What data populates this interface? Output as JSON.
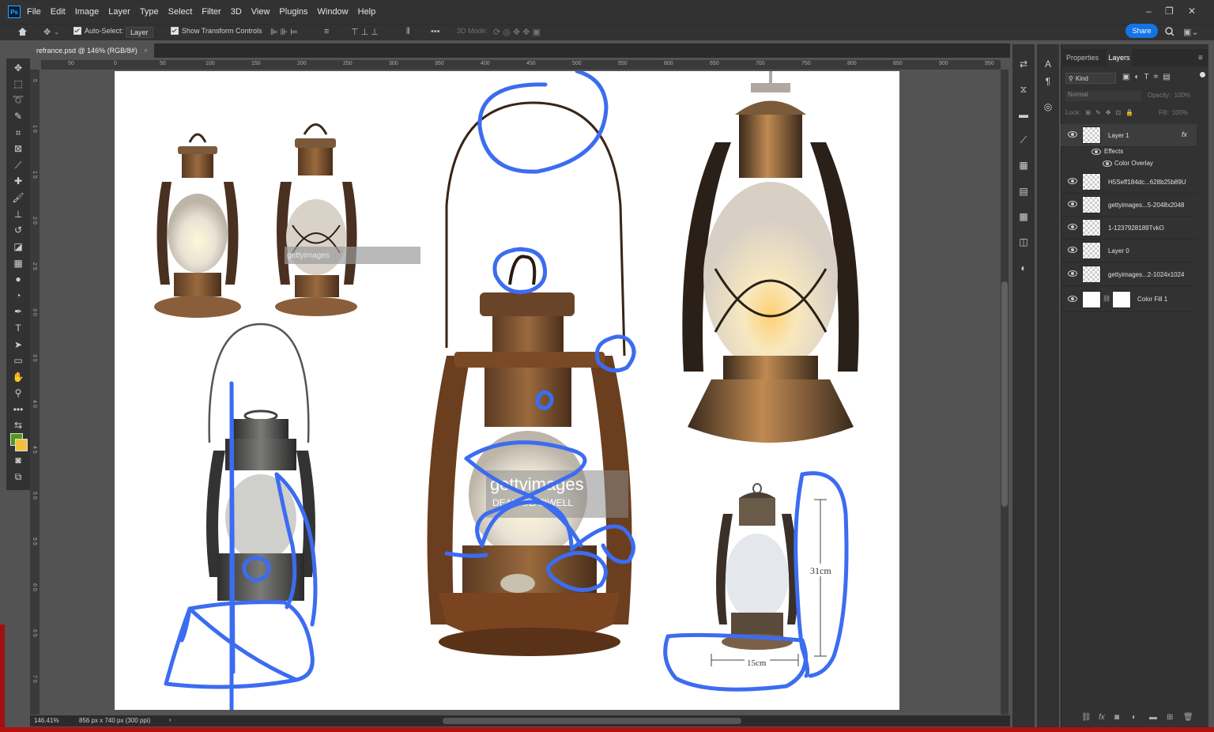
{
  "app": {
    "logo_text": "Ps"
  },
  "menu": [
    "File",
    "Edit",
    "Image",
    "Layer",
    "Type",
    "Select",
    "Filter",
    "3D",
    "View",
    "Plugins",
    "Window",
    "Help"
  ],
  "options_bar": {
    "auto_select_label": "Auto-Select:",
    "auto_select_value": "Layer",
    "show_transform_label": "Show Transform Controls",
    "mode_3d_label": "3D Mode:",
    "share_label": "Share"
  },
  "document": {
    "tab_title": "refrance.psd @ 146% (RGB/8#)",
    "close_glyph": "×",
    "zoom": "146.41%",
    "size_info": "856 px x 740 px (300 ppi)",
    "status_arrow": "›"
  },
  "ruler_top_labels": [
    "50",
    "0",
    "50",
    "100",
    "150",
    "200",
    "250",
    "300",
    "350",
    "400",
    "450",
    "500",
    "550",
    "600",
    "650",
    "700",
    "750",
    "800",
    "850",
    "900",
    "950"
  ],
  "ruler_left_labels": [
    "5",
    "1 0",
    "1 5",
    "2 0",
    "2 5",
    "3 0",
    "3 5",
    "4 0",
    "4 5",
    "5 0",
    "5 5",
    "6 0",
    "6 5",
    "7 0"
  ],
  "canvas_text": {
    "watermark_small": "gettyimages",
    "watermark_large": "gettyimages",
    "watermark_credit": "DEAN GLADWELL",
    "height_dim": "31cm",
    "width_dim": "15cm"
  },
  "panel": {
    "tab_properties": "Properties",
    "tab_layers": "Layers",
    "kind_filter": "Kind",
    "blend_mode": "Normal",
    "opacity_label": "Opacity:",
    "opacity_value": "100%",
    "lock_label": "Lock:",
    "fill_label": "Fill:",
    "fill_value": "100%"
  },
  "layers": [
    {
      "name": "Layer 1",
      "fx": "fx"
    },
    {
      "name": "H5Seff184dc...628b25b89U"
    },
    {
      "name": "gettyimages...5-2048x2048"
    },
    {
      "name": "1-1237928189TvkO"
    },
    {
      "name": "Layer 0"
    },
    {
      "name": "gettyimages...2-1024x1024"
    },
    {
      "name": "Color Fill 1"
    }
  ],
  "layer_effects": {
    "effects": "Effects",
    "color_overlay": "Color Overlay"
  },
  "colors": {
    "foreground": "#4f9a16",
    "background": "#f0c040",
    "annotation_blue": "#3c6cf0",
    "share_blue": "#1473e6"
  }
}
